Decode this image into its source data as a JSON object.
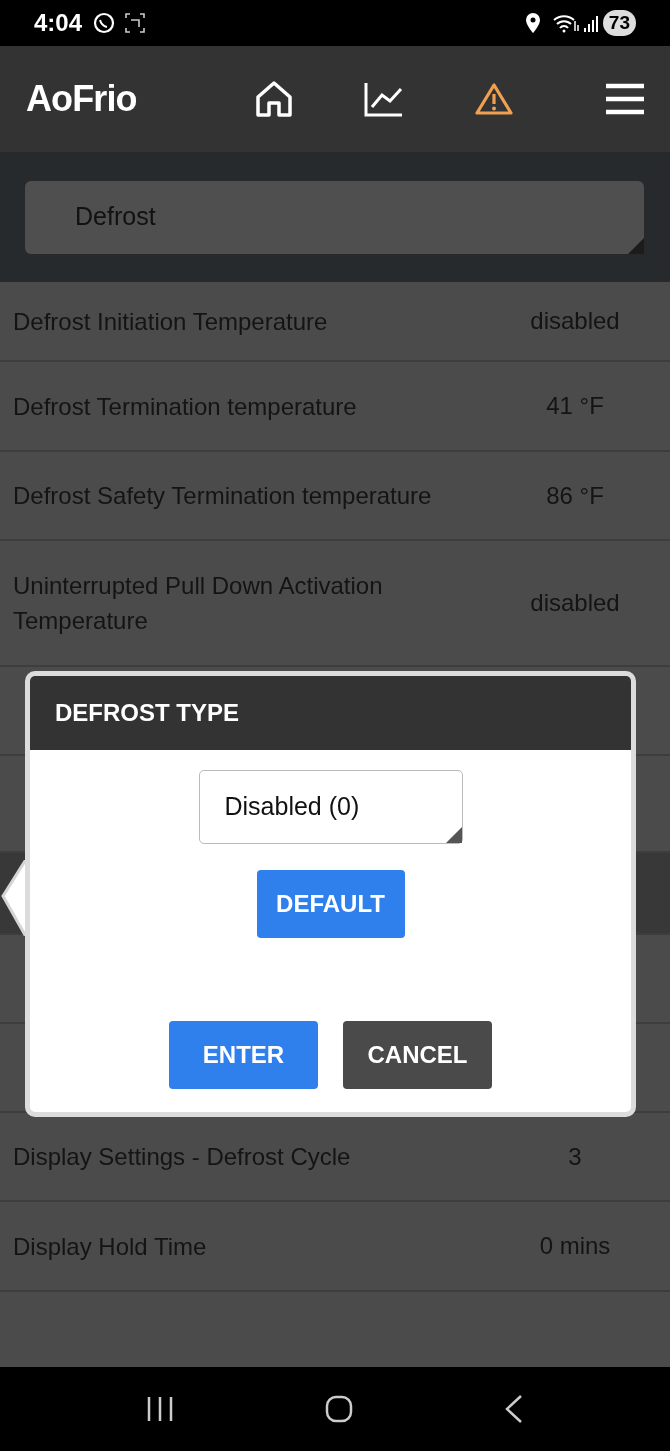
{
  "status_bar": {
    "time": "4:04",
    "battery": "73"
  },
  "header": {
    "logo": "AoFrio"
  },
  "section_select": {
    "value": "Defrost"
  },
  "rows": [
    {
      "label": "Defrost Initiation Temperature",
      "value": "disabled",
      "selected": false
    },
    {
      "label": "Defrost Termination temperature",
      "value": "41 °F",
      "selected": false
    },
    {
      "label": "Defrost Safety Termination temperature",
      "value": "86 °F",
      "selected": false
    },
    {
      "label": "Uninterrupted Pull Down Activation Temperature",
      "value": "disabled",
      "selected": false
    },
    {
      "selected": false
    },
    {
      "selected": false
    },
    {
      "selected": true
    },
    {
      "selected": false
    },
    {
      "selected": false
    },
    {
      "label": "Display Settings - Defrost Cycle",
      "value": "3",
      "selected": false
    },
    {
      "label": "Display Hold Time",
      "value": "0 mins",
      "selected": false
    }
  ],
  "dialog": {
    "title": "DEFROST TYPE",
    "select_value": "Disabled (0)",
    "default_button": "DEFAULT",
    "enter_button": "ENTER",
    "cancel_button": "CANCEL"
  }
}
